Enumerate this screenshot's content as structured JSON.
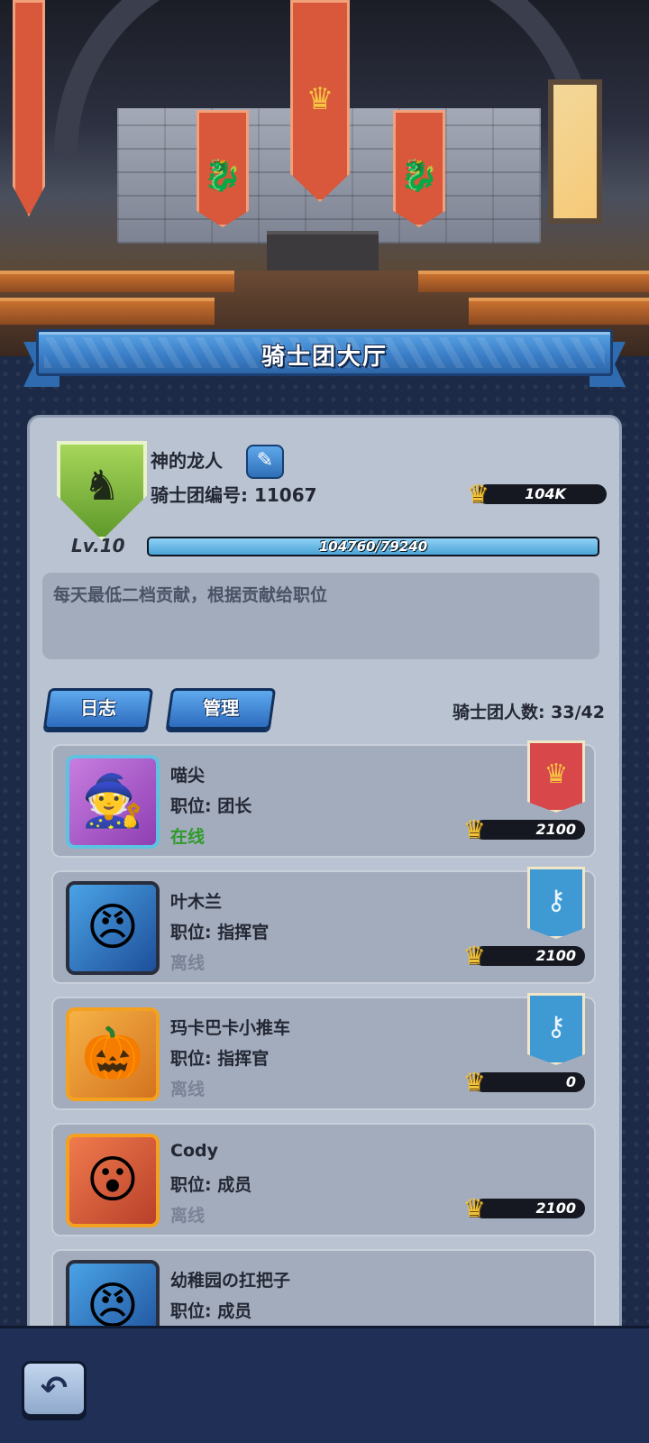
{
  "hall": {
    "banners": [
      "dragon-emblem",
      "crown-emblem",
      "dragon-emblem"
    ]
  },
  "title": "骑士团大厅",
  "guild": {
    "name": "神的龙人",
    "id_text": "骑士团编号: 11067",
    "level": "Lv.10",
    "power": "104K",
    "exp_text": "104760/79240",
    "exp_progress": 1.0,
    "notice": "每天最低二档贡献，根据贡献给职位",
    "emblem_color": "#8cc04a"
  },
  "buttons": {
    "log": "日志",
    "manage": "管理"
  },
  "member_count": "骑士团人数: 33/42",
  "members": [
    {
      "name": "喵尖",
      "role": "职位: 团长",
      "status": "在线",
      "online": true,
      "score": "2100",
      "rank_flag": "leader"
    },
    {
      "name": "叶木兰",
      "role": "职位: 指挥官",
      "status": "离线",
      "online": false,
      "score": "2100",
      "rank_flag": "commander"
    },
    {
      "name": "玛卡巴卡小推车",
      "role": "职位: 指挥官",
      "status": "离线",
      "online": false,
      "score": "0",
      "rank_flag": "commander"
    },
    {
      "name": "Cody",
      "role": "职位: 成员",
      "status": "离线",
      "online": false,
      "score": "2100",
      "rank_flag": ""
    },
    {
      "name": "幼稚园の扛把子",
      "role": "职位: 成员",
      "status": "",
      "online": false,
      "score": "",
      "rank_flag": ""
    }
  ],
  "colors": {
    "accent_blue": "#3b7fc8",
    "online_green": "#2f9a2a",
    "offline_gray": "#7b8497",
    "crown_gold": "#f0c23a"
  },
  "icons": {
    "edit": "pencil-icon",
    "crown": "crown-icon",
    "back": "back-arrow-icon"
  }
}
